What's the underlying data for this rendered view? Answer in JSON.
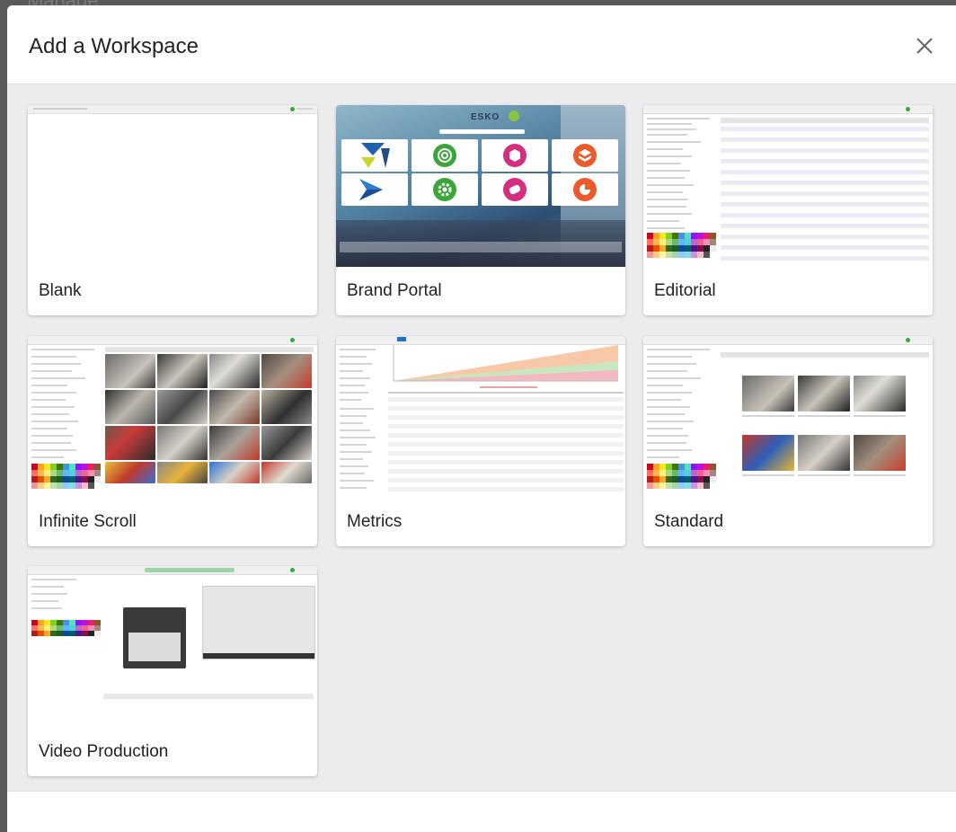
{
  "backdrop": {
    "title": "Manage"
  },
  "modal": {
    "title": "Add a Workspace",
    "close_icon": "close-icon"
  },
  "workspaces": [
    {
      "label": "Blank"
    },
    {
      "label": "Brand Portal",
      "logo_text": "ESKO"
    },
    {
      "label": "Editorial"
    },
    {
      "label": "Infinite Scroll"
    },
    {
      "label": "Metrics"
    },
    {
      "label": "Standard"
    },
    {
      "label": "Video Production"
    }
  ],
  "colors": {
    "overlay": "#5a5a5a",
    "body_bg": "#ececef",
    "card_bg": "#ffffff",
    "text": "#222222",
    "accent_green": "#3aa63a",
    "accent_magenta": "#d42e7e",
    "accent_orange": "#ea5a2a",
    "accent_blue": "#1f5fae"
  }
}
